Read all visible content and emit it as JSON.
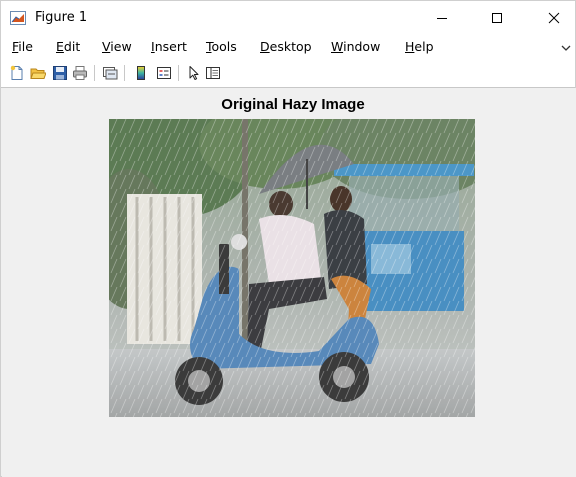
{
  "window": {
    "title": "Figure 1",
    "icon": "matlab-figure-icon",
    "controls": [
      "minimize-icon",
      "maximize-icon",
      "close-icon"
    ]
  },
  "menu": {
    "items": [
      {
        "name": "file",
        "accel": "F",
        "rest": "ile"
      },
      {
        "name": "edit",
        "accel": "E",
        "rest": "dit"
      },
      {
        "name": "view",
        "accel": "V",
        "rest": "iew"
      },
      {
        "name": "insert",
        "accel": "I",
        "rest": "nsert"
      },
      {
        "name": "tools",
        "accel": "T",
        "rest": "ools"
      },
      {
        "name": "desktop",
        "accel": "D",
        "rest": "esktop"
      },
      {
        "name": "window",
        "accel": "W",
        "rest": "indow"
      },
      {
        "name": "help",
        "accel": "H",
        "rest": "elp"
      }
    ]
  },
  "toolbar": {
    "buttons": [
      "new-figure-icon",
      "open-file-icon",
      "save-figure-icon",
      "print-figure-icon",
      "link-plot-icon",
      "insert-colorbar-icon",
      "insert-legend-icon",
      "edit-plot-arrow-icon",
      "property-inspector-icon"
    ]
  },
  "axes": {
    "title": "Original Hazy Image",
    "image_description_icon": "hazy-rain-scooter-photo"
  }
}
